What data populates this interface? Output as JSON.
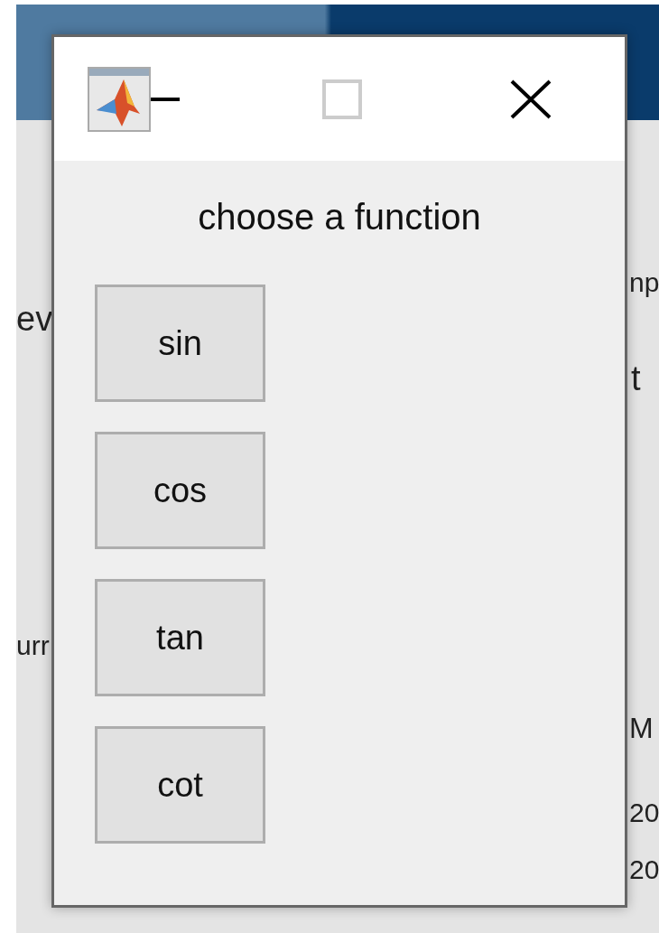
{
  "background_app": {
    "left_fragments": [
      {
        "text": "ev",
        "kind": "text"
      },
      {
        "text": "urr",
        "kind": "text"
      }
    ],
    "right_fragments": [
      {
        "text": "np",
        "kind": "text"
      },
      {
        "text": "t",
        "kind": "text"
      },
      {
        "text": "M",
        "kind": "text"
      },
      {
        "text": "20",
        "kind": "text"
      },
      {
        "text": "20",
        "kind": "text"
      }
    ]
  },
  "dialog": {
    "prompt": "choose a function",
    "buttons": [
      {
        "label": "sin"
      },
      {
        "label": "cos"
      },
      {
        "label": "tan"
      },
      {
        "label": "cot"
      }
    ]
  }
}
